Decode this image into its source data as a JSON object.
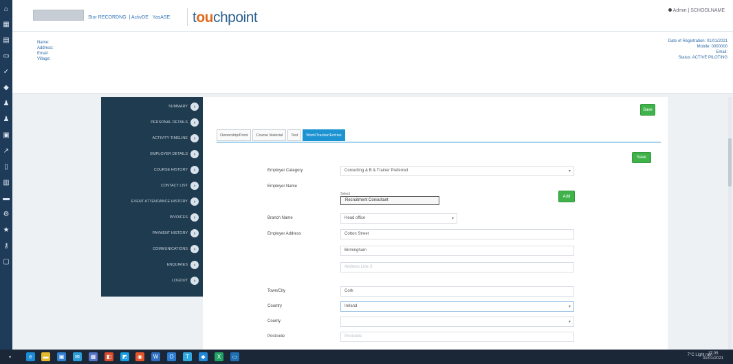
{
  "header": {
    "brand_prefix": "t",
    "brand_accent": "ou",
    "brand_suffix": "chpoint",
    "links": [
      "Stor RECORDNG",
      "ActivDE",
      "YasASE"
    ],
    "user": "Admin | SCHOOLNAME"
  },
  "info": {
    "left_lines": [
      "Name:",
      "Address:",
      "Email:",
      "Village:"
    ],
    "right_lines": [
      "Date of Registration: 01/01/2021",
      "Mobile: 0000000",
      "Email:",
      "Status: ACTIVE PILOTING"
    ]
  },
  "nav": {
    "items": [
      "SUMMARY",
      "PERSONAL DETAILS",
      "ACTIVITY TIMELINE",
      "EMPLOYER DETAILS",
      "COURSE HISTORY",
      "CONTACT LIST",
      "EVENT ATTENDANCE HISTORY",
      "INVOICES",
      "PAYMENT HISTORY",
      "COMMUNICATIONS",
      "ENQUIRIES",
      "LOGOUT"
    ]
  },
  "main": {
    "save_top": "Save",
    "add_button": "Add",
    "save_tab": "Save",
    "tabs": [
      "Ownership/Point",
      "Course Material",
      "Test",
      "Work/Tracker/Entries"
    ],
    "active_tab_index": 3,
    "fields": {
      "employer_category_label": "Employer Category",
      "employer_category_value": "Consulting & B & Trainer Preferred",
      "employer_name_label": "Employer Name",
      "employer_name_mini": "Select",
      "employer_name_value": "Recruitment Consultant",
      "branch_name_label": "Branch Name",
      "branch_name_value": "Head office",
      "employer_address_label": "Employer Address",
      "address_1": "Cotton Street",
      "address_2": "Birmingham",
      "address_3_placeholder": "Address Line 3",
      "town_city_label": "Town/City",
      "town_city_value": "Cork",
      "country_label": "Country",
      "country_value": "Ireland",
      "county_label": "County",
      "county_value": "",
      "postcode_label": "Postcode",
      "postcode_placeholder": "Postcode"
    }
  },
  "taskbar": {
    "tray": "7°C Light rain",
    "time": "17:05",
    "date": "01/01/2021"
  },
  "colors": {
    "rail": "#1f3b5a",
    "nav": "#1f3b4f",
    "accent": "#1e93d2",
    "green": "#3fb34a",
    "brand": "#2a5f8f",
    "brand_accent": "#e06a1d"
  }
}
